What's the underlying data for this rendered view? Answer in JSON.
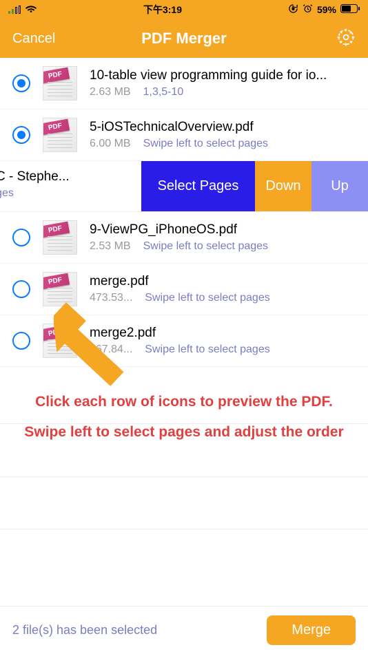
{
  "status": {
    "time": "下午3:19",
    "battery": "59%"
  },
  "nav": {
    "cancel": "Cancel",
    "title": "PDF Merger"
  },
  "files": [
    {
      "name": "10-table view programming guide for io...",
      "size": "2.63 MB",
      "pages": "1,3,5-10",
      "selected": true
    },
    {
      "name": "5-iOSTechnicalOverview.pdf",
      "size": "6.00 MB",
      "pages": "Swipe left to select pages",
      "selected": true
    }
  ],
  "swipe": {
    "name": "ective-C - Stephe...",
    "pages": "elect pages",
    "actions": {
      "select": "Select Pages",
      "down": "Down",
      "up": "Up"
    }
  },
  "files2": [
    {
      "name": "9-ViewPG_iPhoneOS.pdf",
      "size": "2.53 MB",
      "pages": "Swipe left to select pages",
      "selected": false
    },
    {
      "name": "merge.pdf",
      "size": "473.53...",
      "pages": "Swipe left to select pages",
      "selected": false
    },
    {
      "name": "merge2.pdf",
      "size": "267.84...",
      "pages": "Swipe left to select pages",
      "selected": false
    }
  ],
  "help": {
    "line1": "Click each row of icons to preview the PDF.",
    "line2": "Swipe left to select pages and adjust the order"
  },
  "footer": {
    "selected": "2 file(s) has been selected",
    "merge": "Merge"
  }
}
